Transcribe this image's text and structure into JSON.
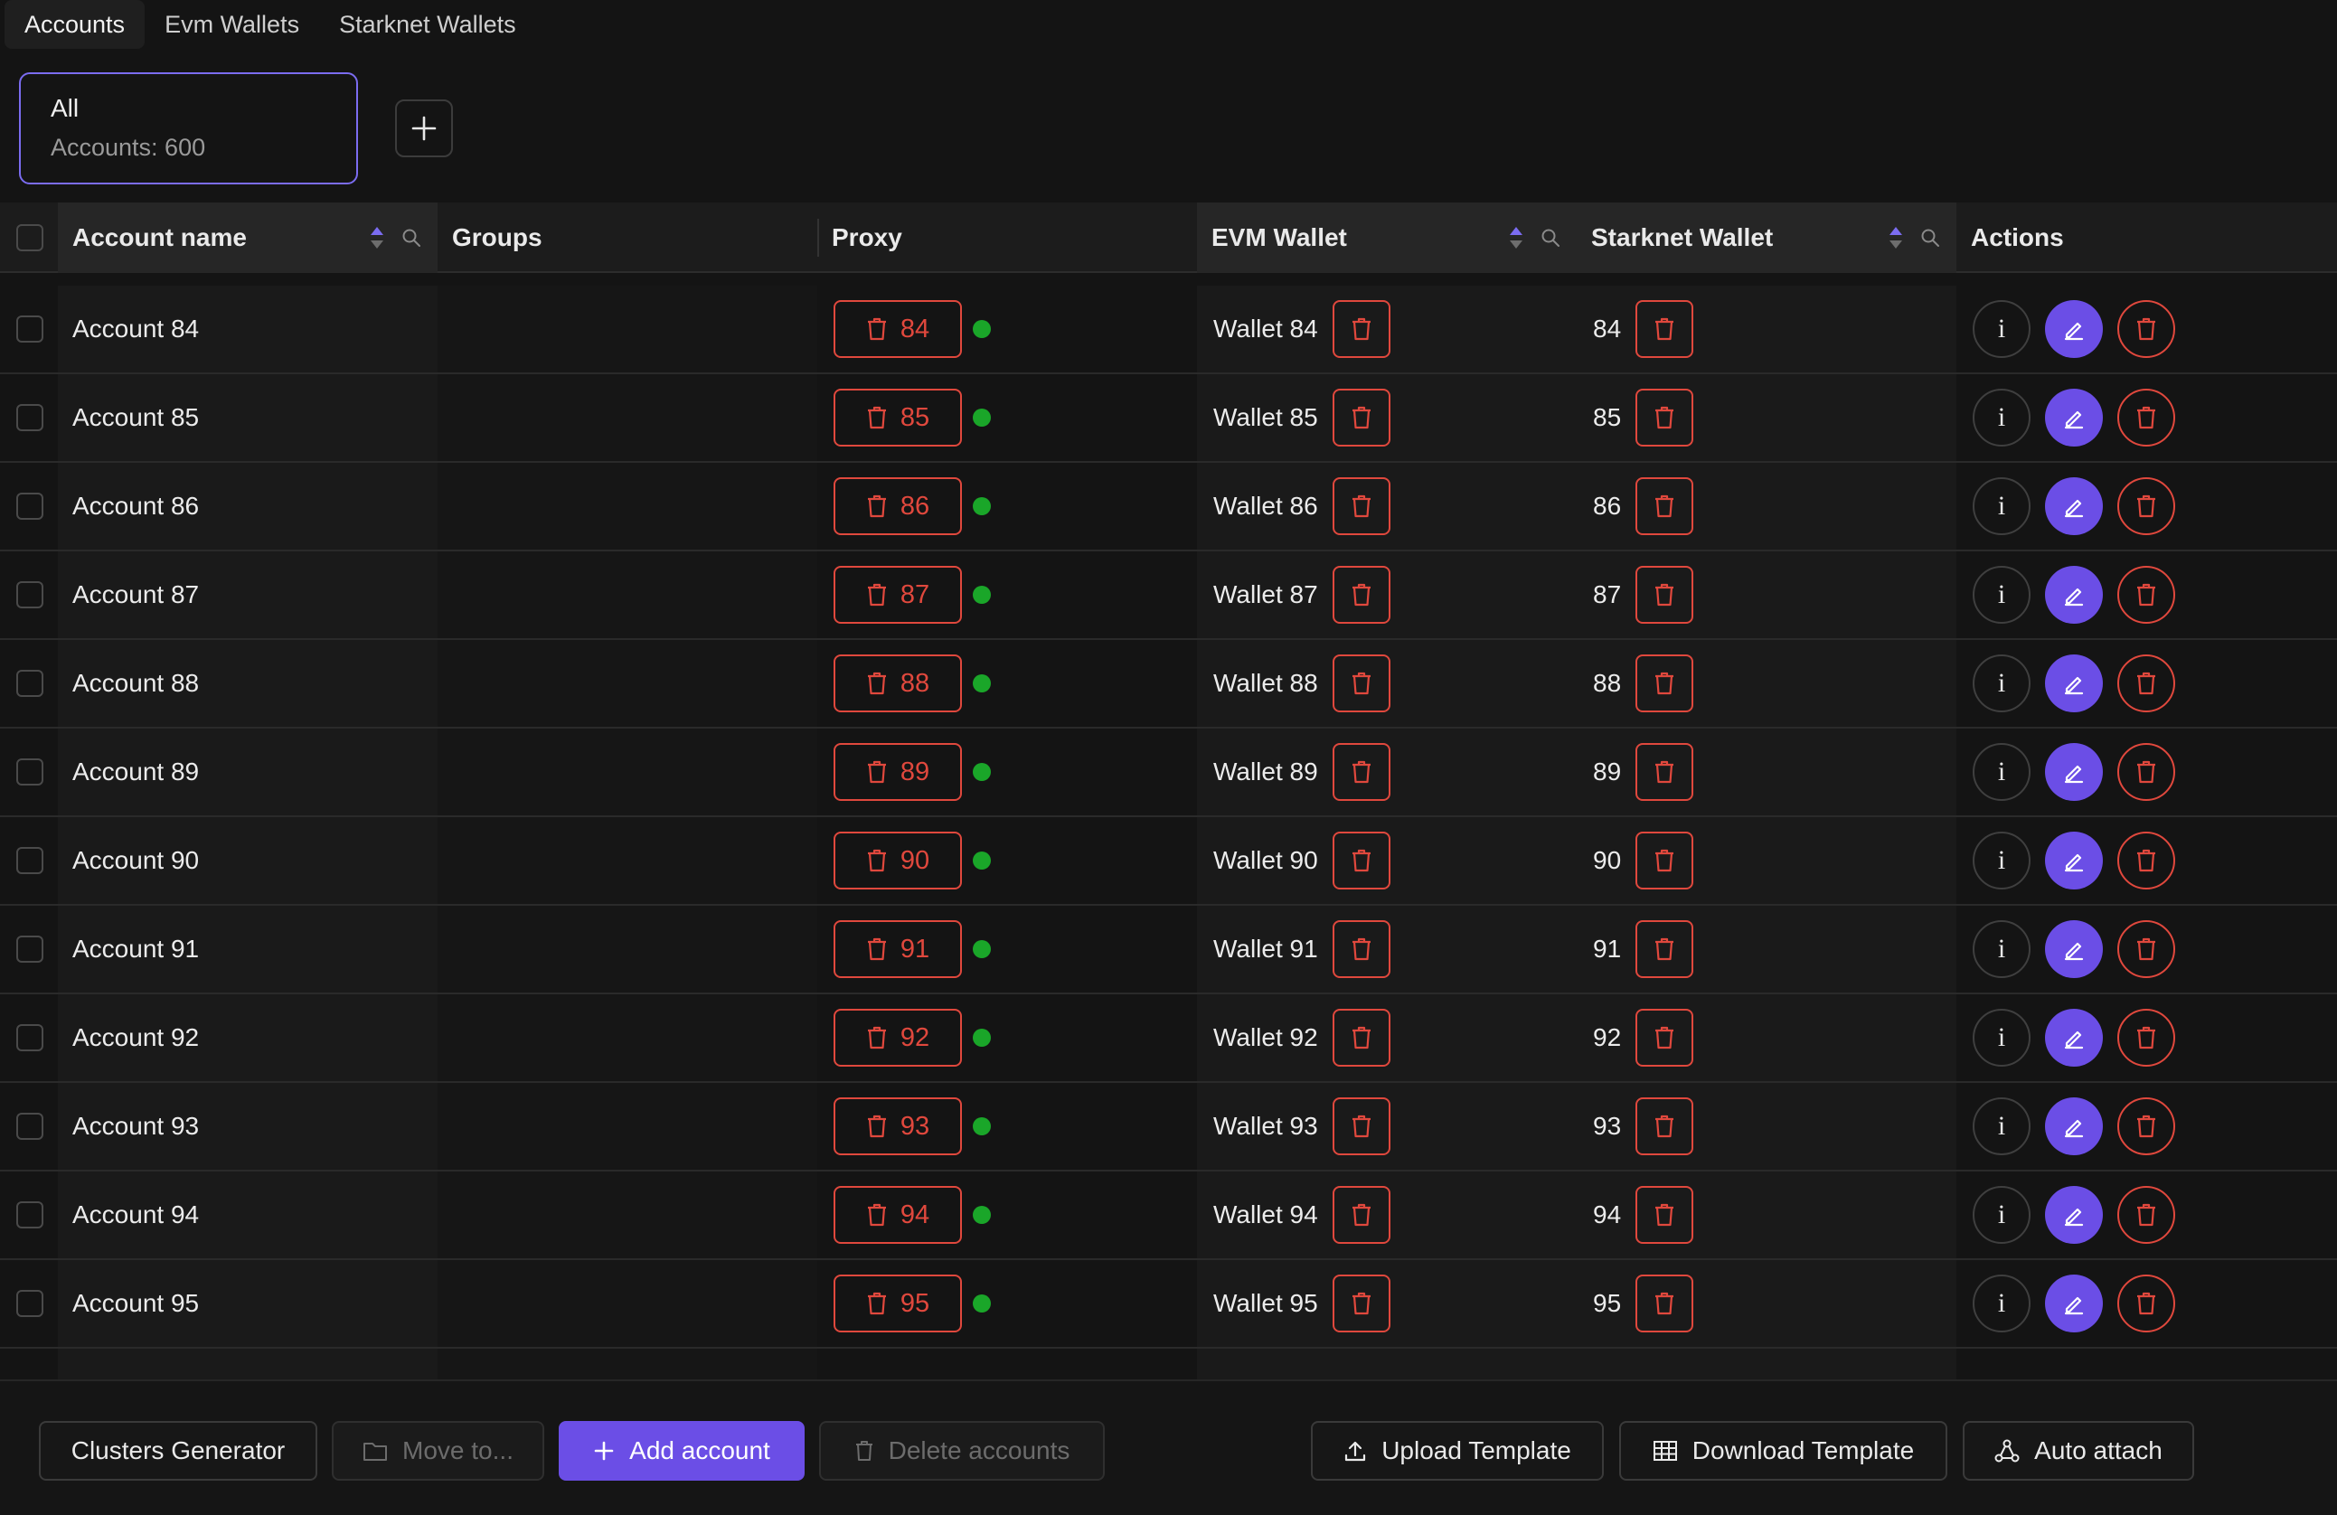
{
  "tabs": [
    "Accounts",
    "Evm Wallets",
    "Starknet Wallets"
  ],
  "group_card": {
    "name": "All",
    "count": "Accounts: 600"
  },
  "table": {
    "headers": {
      "account_name": "Account name",
      "groups": "Groups",
      "proxy": "Proxy",
      "evm_wallet": "EVM Wallet",
      "starknet_wallet": "Starknet Wallet",
      "actions": "Actions"
    },
    "rows": [
      {
        "name": "Account 84",
        "proxy": "84",
        "evm": "Wallet 84",
        "starknet": "84"
      },
      {
        "name": "Account 85",
        "proxy": "85",
        "evm": "Wallet 85",
        "starknet": "85"
      },
      {
        "name": "Account 86",
        "proxy": "86",
        "evm": "Wallet 86",
        "starknet": "86"
      },
      {
        "name": "Account 87",
        "proxy": "87",
        "evm": "Wallet 87",
        "starknet": "87"
      },
      {
        "name": "Account 88",
        "proxy": "88",
        "evm": "Wallet 88",
        "starknet": "88"
      },
      {
        "name": "Account 89",
        "proxy": "89",
        "evm": "Wallet 89",
        "starknet": "89"
      },
      {
        "name": "Account 90",
        "proxy": "90",
        "evm": "Wallet 90",
        "starknet": "90"
      },
      {
        "name": "Account 91",
        "proxy": "91",
        "evm": "Wallet 91",
        "starknet": "91"
      },
      {
        "name": "Account 92",
        "proxy": "92",
        "evm": "Wallet 92",
        "starknet": "92"
      },
      {
        "name": "Account 93",
        "proxy": "93",
        "evm": "Wallet 93",
        "starknet": "93"
      },
      {
        "name": "Account 94",
        "proxy": "94",
        "evm": "Wallet 94",
        "starknet": "94"
      },
      {
        "name": "Account 95",
        "proxy": "95",
        "evm": "Wallet 95",
        "starknet": "95"
      }
    ]
  },
  "footer": {
    "clusters_generator": "Clusters Generator",
    "move_to": "Move to...",
    "add_account": "Add account",
    "delete_accounts": "Delete accounts",
    "upload_template": "Upload Template",
    "download_template": "Download Template",
    "auto_attach": "Auto attach"
  },
  "colors": {
    "accent": "#6b4ee6",
    "danger": "#e0483d",
    "status_ok": "#1aa629"
  },
  "icons": [
    "plus-icon",
    "sort-icon",
    "search-icon",
    "trash-icon",
    "edit-icon",
    "info-icon",
    "folder-icon",
    "upload-icon",
    "table-icon",
    "share-icon"
  ]
}
